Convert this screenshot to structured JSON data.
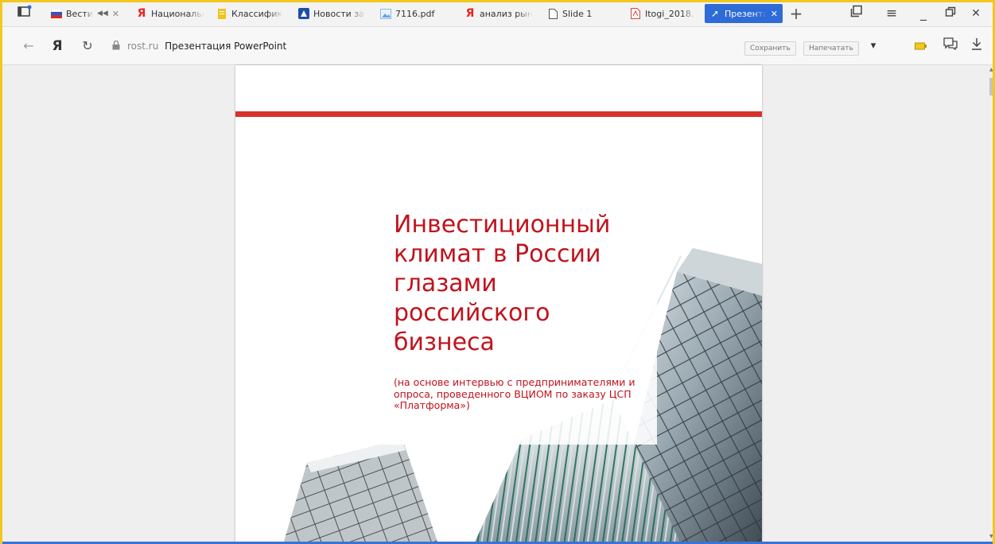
{
  "tabs": [
    {
      "label": "Вести",
      "favicon": "russia-flag-icon",
      "muted": true,
      "closable": true
    },
    {
      "label": "Национальн",
      "favicon": "yandex-icon"
    },
    {
      "label": "Классифика",
      "favicon": "document-yellow-icon"
    },
    {
      "label": "Новости за",
      "favicon": "news-icon"
    },
    {
      "label": "7116.pdf",
      "favicon": "image-file-icon"
    },
    {
      "label": "анализ рын",
      "favicon": "yandex-icon"
    },
    {
      "label": "Slide 1",
      "favicon": "page-icon"
    },
    {
      "label": "Itogi_2018.",
      "favicon": "pdf-icon"
    },
    {
      "label": "Презента",
      "favicon": "arrow-icon",
      "active": true,
      "closable": true
    }
  ],
  "address": {
    "domain": "rost.ru",
    "page_title": "Презентация PowerPoint",
    "save_label": "Сохранить",
    "print_label": "Напечатать"
  },
  "slide": {
    "title": "Инвестиционный климат в России глазами российского бизнеса",
    "subtitle": "(на основе интервью с предпринимателями и опроса, проведенного ВЦИОМ по заказу ЦСП «Платформа»)"
  },
  "colors": {
    "accent": "#2e6bd6",
    "window_frame": "#f2c71f",
    "slide_red": "#c0131c",
    "slide_bar": "#d8312c"
  }
}
